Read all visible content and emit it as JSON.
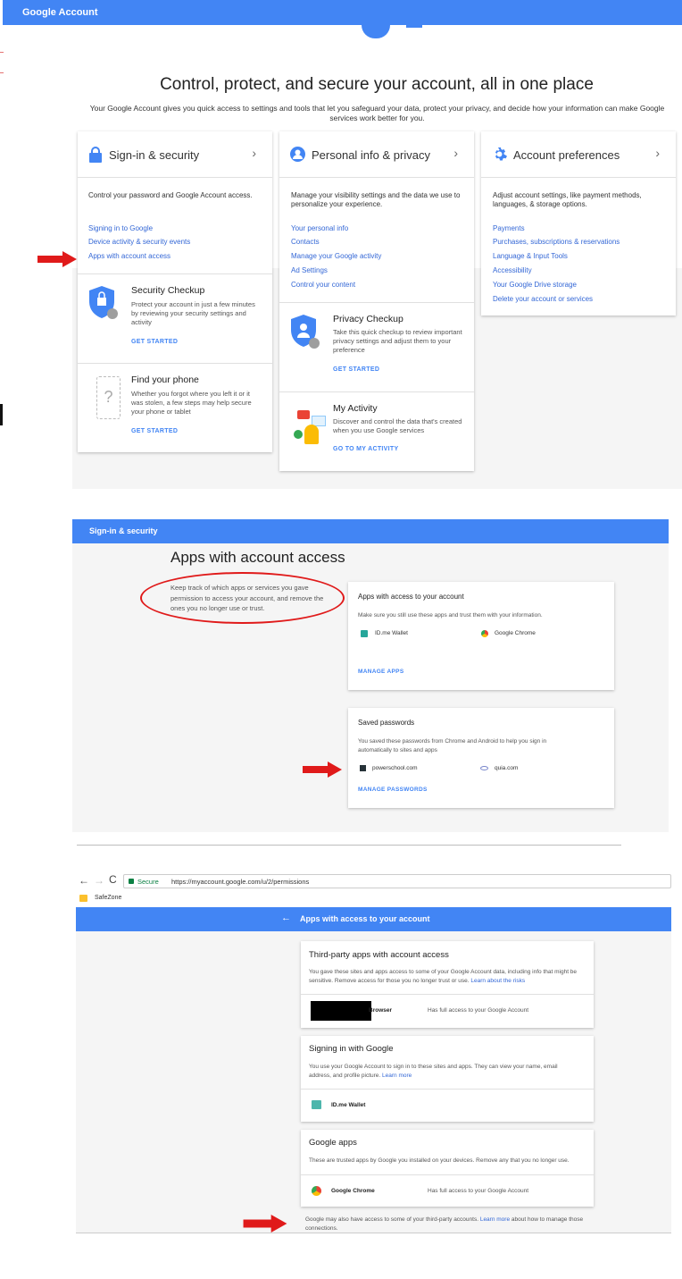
{
  "topbar": {
    "title": "Google Account"
  },
  "hero": {
    "title": "Control, protect, and secure your account, all in one place",
    "subtitle": "Your Google Account gives you quick access to settings and tools that let you safeguard your data, protect your privacy, and decide how your information can make Google services work better for you."
  },
  "cards": {
    "signin": {
      "title": "Sign-in & security",
      "desc": "Control your password and Google Account access.",
      "links": [
        "Signing in to Google",
        "Device activity & security events",
        "Apps with account access"
      ],
      "checkup": {
        "title": "Security Checkup",
        "desc": "Protect your account in just a few minutes by reviewing your security settings and activity",
        "cta": "GET STARTED"
      },
      "phone": {
        "title": "Find your phone",
        "desc": "Whether you forgot where you left it or it was stolen, a few steps may help secure your phone or tablet",
        "cta": "GET STARTED"
      }
    },
    "privacy": {
      "title": "Personal info & privacy",
      "desc": "Manage your visibility settings and the data we use to personalize your experience.",
      "links": [
        "Your personal info",
        "Contacts",
        "Manage your Google activity",
        "Ad Settings",
        "Control your content"
      ],
      "checkup": {
        "title": "Privacy Checkup",
        "desc": "Take this quick checkup to review important privacy settings and adjust them to your preference",
        "cta": "GET STARTED"
      },
      "activity": {
        "title": "My Activity",
        "desc": "Discover and control the data that's created when you use Google services",
        "cta": "GO TO MY ACTIVITY"
      }
    },
    "prefs": {
      "title": "Account preferences",
      "desc": "Adjust account settings, like payment methods, languages, & storage options.",
      "links": [
        "Payments",
        "Purchases, subscriptions & reservations",
        "Language & Input Tools",
        "Accessibility",
        "Your Google Drive storage",
        "Delete your account or services"
      ]
    }
  },
  "section2": {
    "bar": "Sign-in & security",
    "title": "Apps with account access",
    "desc": "Keep track of which apps or services you gave permission to access your account, and remove the ones you no longer use or trust.",
    "apps_card": {
      "title": "Apps with access to your account",
      "desc": "Make sure you still use these apps and trust them with your information.",
      "apps": [
        "ID.me Wallet",
        "Google Chrome"
      ],
      "cta": "MANAGE APPS"
    },
    "pw_card": {
      "title": "Saved passwords",
      "desc": "You saved these passwords from Chrome and Android to help you sign in automatically to sites and apps",
      "sites": [
        "powerschool.com",
        "quia.com"
      ],
      "cta": "MANAGE PASSWORDS"
    }
  },
  "section3": {
    "browser": {
      "secure": "Secure",
      "url": "https://myaccount.google.com/u/2/permissions",
      "bookmark": "SafeZone"
    },
    "bar": "Apps with access to your account",
    "third": {
      "title": "Third-party apps with account access",
      "desc": "You gave these sites and apps access to some of your Google Account data, including info that might be sensitive. Remove access for those you no longer trust or use.",
      "learn": "Learn about the risks",
      "app": "Browser",
      "access": "Has full access to your Google Account"
    },
    "signin": {
      "title": "Signing in with Google",
      "desc": "You use your Google Account to sign in to these sites and apps. They can view your name, email address, and profile picture.",
      "learn": "Learn more",
      "app": "ID.me Wallet"
    },
    "gapps": {
      "title": "Google apps",
      "desc": "These are trusted apps by Google you installed on your devices. Remove any that you no longer use.",
      "app": "Google Chrome",
      "access": "Has full access to your Google Account"
    },
    "footer": {
      "pre": "Google may also have access to some of your third-party accounts.",
      "learn": "Learn more",
      "post": "about how to manage those connections."
    }
  }
}
